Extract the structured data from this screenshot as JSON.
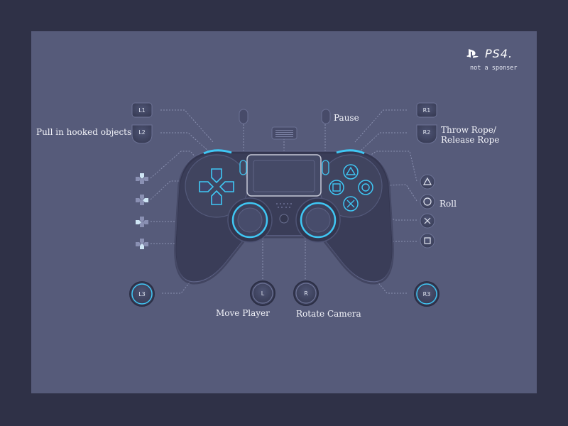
{
  "brand": {
    "logo_text": "PS4.",
    "note": "not a sponser"
  },
  "buttons": {
    "l1": "L1",
    "l2": "L2",
    "r1": "R1",
    "r2": "R2",
    "l3": "L3",
    "r3": "R3",
    "left_stick": "L",
    "right_stick": "R"
  },
  "labels": {
    "l2_action": "Pull in hooked objects",
    "options_action": "Pause",
    "r2_action_line1": "Throw Rope/",
    "r2_action_line2": "Release Rope",
    "circle_action": "Roll",
    "left_stick_action": "Move Player",
    "right_stick_action": "Rotate Camera"
  },
  "colors": {
    "background": "#2f3147",
    "panel": "#565b7a",
    "accent": "#3fc7f4",
    "controller": "#3a3d58"
  }
}
